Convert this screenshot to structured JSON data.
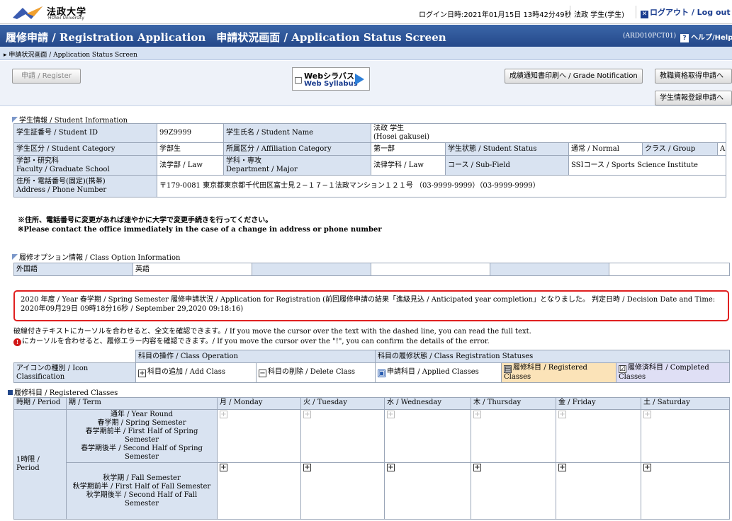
{
  "header": {
    "logo_name": "法政大学",
    "logo_sub": "HOSEI University",
    "login_time": "ログイン日時:2021年01月15日 13時42分49秒",
    "user": "法政 学生(学生)",
    "logout_label": "ログアウト / Log out"
  },
  "title": {
    "main": "履修申請 / Registration Application　申請状況画面 / Application Status Screen",
    "screen_id": "(ARD010PCT01)",
    "help_label": "ヘルプ/Help"
  },
  "breadcrumb": "申請状況画面 / Application Status Screen",
  "toolbar": {
    "register": "申請 / Register",
    "web_syllabus_ja": "Webシラバス",
    "web_syllabus_en": "Web Syllabus",
    "grade_notification": "成績通知書印刷へ / Grade Notification",
    "career": "教職資格取得申請へ",
    "student_info": "学生情報登録申請へ"
  },
  "student_info": {
    "section_title": "学生情報 / Student Information",
    "id_label": "学生証番号 / Student ID",
    "id_value": "99Z9999",
    "name_label": "学生氏名 / Student Name",
    "name_value": "法政 学生",
    "name_kana": "(Hosei gakusei)",
    "category_label": "学生区分 / Student Category",
    "category_value": "学部生",
    "affiliation_label": "所属区分 / Affiliation Category",
    "affiliation_value": "第一部",
    "status_label": "学生状態 / Student Status",
    "status_value": "通常 / Normal",
    "class_label": "クラス / Group",
    "class_value": "A",
    "faculty_label_ja": "学部・研究科",
    "faculty_label_en": "Faculty / Graduate School",
    "faculty_value": "法学部 / Law",
    "major_label_ja": "学科・専攻",
    "major_label_en": "Department / Major",
    "major_value": "法律学科 / Law",
    "subfield_label": "コース / Sub-Field",
    "subfield_value": "SSIコース / Sports Science Institute",
    "address_label_ja": "住所・電話番号(固定)(携帯)",
    "address_label_en": "Address / Phone Number",
    "address_value": "〒179-0081 東京都東京都千代田区富士見２−１７−１法政マンション１２１号 （03-9999-9999）（03-9999-9999）",
    "notice_ja": "※住所、電話番号に変更があれば速やかに大学で変更手続きを行ってください。",
    "notice_en": "※Please contact the office immediately in the case of a change in address or phone number"
  },
  "class_option": {
    "section_title": "履修オプション情報 / Class Option Information",
    "label": "外国語",
    "value": "英語"
  },
  "status_message": "2020 年度 / Year  春学期 / Spring Semester   履修申請状況 / Application for Registration (前回履修申請の結果「進級見込 / Anticipated year completion」となりました。  判定日時 / Decision Date and Time:  2020年09月29日 09時18分16秒 / September 29,2020 09:18:16)",
  "hover_note_1": "破線付きテキストにカーソルを合わせると、全文を確認できます。/ If you move the cursor over the text with the dashed line, you can read the full text.",
  "hover_note_2": "にカーソルを合わせると、履修エラー内容を確認できます。/ If you move the cursor over the \"!\", you can confirm the details of the error.",
  "legend": {
    "operation_header": "科目の操作 / Class Operation",
    "status_header": "科目の履修状態 / Class Registration Statuses",
    "icon_label": "アイコンの種別 / Icon Classification",
    "add": "科目の追加 / Add Class",
    "delete": "科目の削除 / Delete Class",
    "applied": "申請科目 / Applied Classes",
    "registered": "履修科目 / Registered Classes",
    "completed": "履修済科目 / Completed Classes",
    "registered_color": "#fbe3b8",
    "completed_color": "#dfdff5"
  },
  "registered": {
    "section_title": "履修科目 / Registered Classes",
    "headers": [
      "時期 / Period",
      "期 / Term",
      "月 / Monday",
      "火 / Tuesday",
      "水 / Wednesday",
      "木 / Thursday",
      "金 / Friday",
      "土 / Saturday"
    ],
    "period": "1時限 / Period",
    "term_group_1": [
      "通年 / Year Round",
      "春学期 / Spring Semester",
      "春学期前半 / First Half of Spring Semester",
      "春学期後半 / Second Half of Spring Semester"
    ],
    "term_group_2": [
      "秋学期 / Fall Semester",
      "秋学期前半 / First Half of Fall Semester",
      "秋学期後半 / Second Half of Fall Semester"
    ]
  }
}
